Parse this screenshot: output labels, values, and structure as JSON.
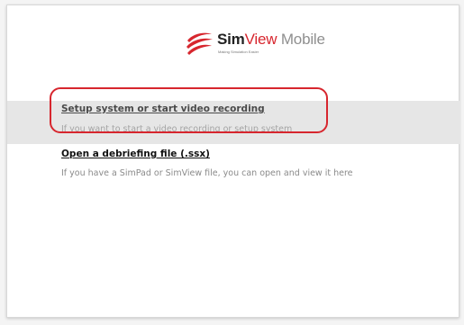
{
  "logo": {
    "brand_sim": "Sim",
    "brand_view": "View",
    "brand_mobile": " Mobile",
    "tagline": "Making Simulation Easier",
    "colors": {
      "accent": "#d7262e",
      "dark": "#222222",
      "muted": "#8f8f8f"
    }
  },
  "options": {
    "setup": {
      "title": "Setup system or start video recording",
      "description": "If you want to start a video recording or setup system"
    },
    "debrief": {
      "title": "Open a debriefing file (.ssx)",
      "description": "If you have a SimPad or SimView file, you can open and view it here"
    }
  },
  "annotation": {
    "highlight_color": "#d7262e",
    "highlighted_option": "setup"
  }
}
